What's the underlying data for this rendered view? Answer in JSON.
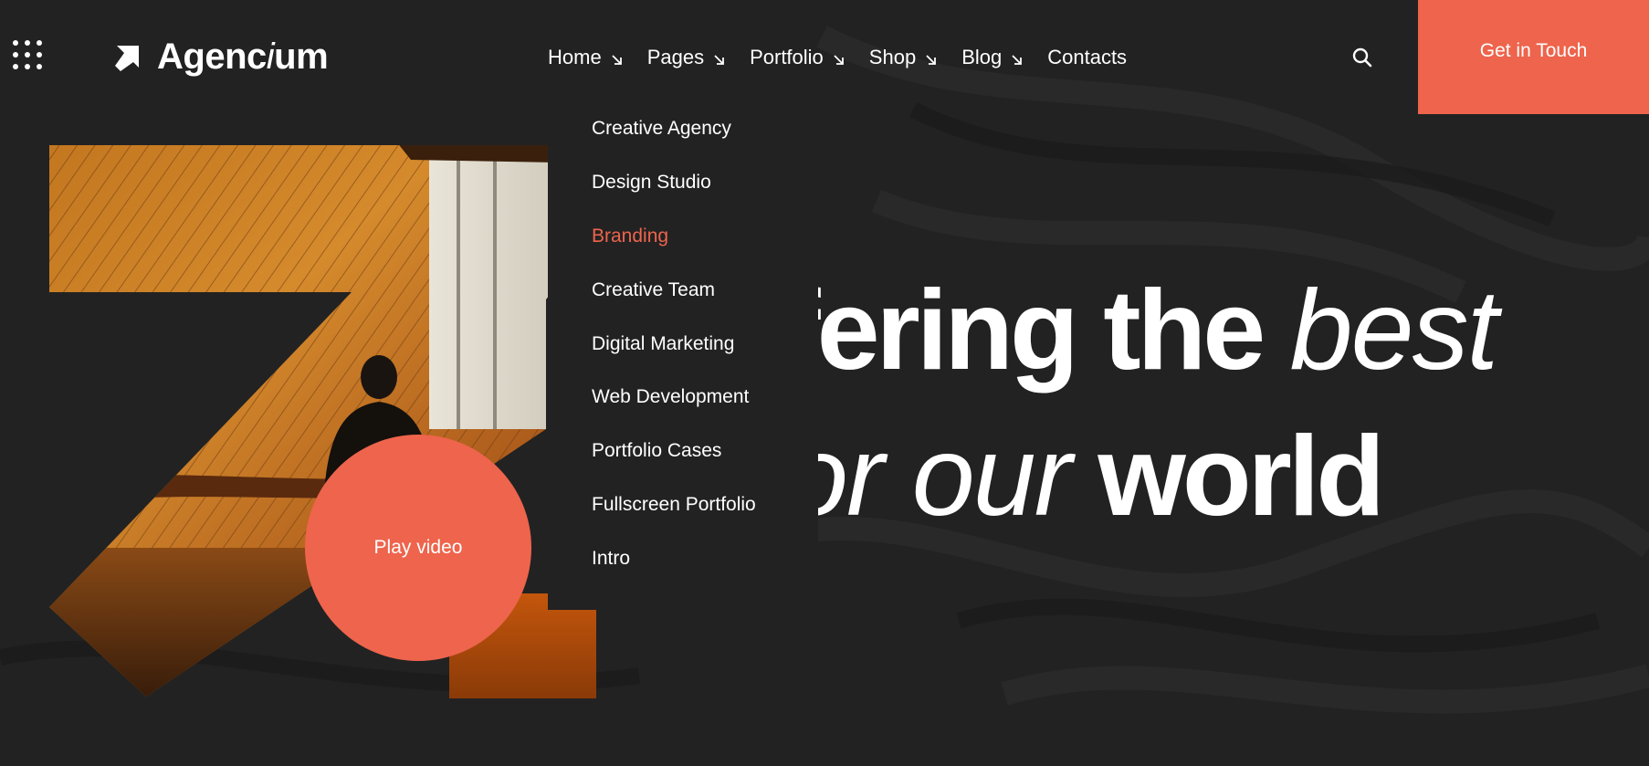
{
  "brand": {
    "name_bold": "Agenc",
    "name_italic": "i",
    "name_rest": "um"
  },
  "header": {
    "menu_icon": "grid-dots-icon",
    "logo_icon": "arrow-up-right-icon",
    "search_icon": "search-icon",
    "cta_label": "Get in Touch"
  },
  "nav": {
    "items": [
      {
        "label": "Home",
        "has_dropdown": true
      },
      {
        "label": "Pages",
        "has_dropdown": true
      },
      {
        "label": "Portfolio",
        "has_dropdown": true
      },
      {
        "label": "Shop",
        "has_dropdown": true
      },
      {
        "label": "Blog",
        "has_dropdown": true
      },
      {
        "label": "Contacts",
        "has_dropdown": false
      }
    ],
    "dropdown_icon": "arrow-down-right-icon"
  },
  "dropdown": {
    "parent": "Home",
    "items": [
      {
        "label": "Creative Agency"
      },
      {
        "label": "Design Studio"
      },
      {
        "label": "Branding",
        "active": true
      },
      {
        "label": "Creative Team"
      },
      {
        "label": "Digital Marketing"
      },
      {
        "label": "Web Development"
      },
      {
        "label": "Portfolio Cases"
      },
      {
        "label": "Fullscreen Portfolio"
      },
      {
        "label": "Intro"
      }
    ]
  },
  "hero": {
    "line1_bold": "ffering the",
    "line1_italic": "best",
    "line2_italic": "or our",
    "line2_bold": "world",
    "play_label": "Play video"
  },
  "colors": {
    "background": "#222222",
    "accent": "#ee644c",
    "text": "#ffffff"
  }
}
